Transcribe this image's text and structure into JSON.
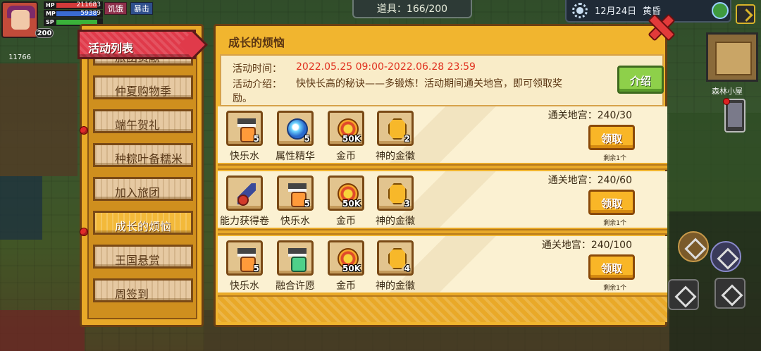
{
  "hud": {
    "level": "200",
    "hp_label": "HP",
    "hp_value": "211683",
    "mp_label": "MP",
    "mp_value": "59389",
    "sp_label": "SP",
    "status_hunger": "饥饿",
    "status_crit": "暴击",
    "coins": "11766",
    "items_text": "道具：166/200",
    "date": "12月24日",
    "time_of_day": "黄昏",
    "location": "森林小屋",
    "icons": [
      "portrait-icon",
      "sun-icon",
      "globe-icon",
      "exit-icon",
      "phone-icon",
      "minimap"
    ]
  },
  "sidebar": {
    "title": "活动列表",
    "items": [
      {
        "label": "旅团贡献",
        "badge": false,
        "active": false
      },
      {
        "label": "仲夏购物季",
        "badge": false,
        "active": false
      },
      {
        "label": "端午贺礼",
        "badge": true,
        "active": false
      },
      {
        "label": "种粽叶备糯米",
        "badge": false,
        "active": false
      },
      {
        "label": "加入旅团",
        "badge": false,
        "active": false
      },
      {
        "label": "成长的烦恼",
        "badge": true,
        "active": true
      },
      {
        "label": "王国悬赏",
        "badge": false,
        "active": false
      },
      {
        "label": "周签到",
        "badge": false,
        "active": false
      }
    ]
  },
  "panel": {
    "title": "成长的烦恼",
    "time_label": "活动时间：",
    "time_value": "2022.05.25 09:00-2022.06.28 23:59",
    "desc_label": "活动介绍：",
    "desc_value": "快快长高的秘诀——多锻炼！活动期间通关地宫，即可领取奖",
    "desc_line2": "励。",
    "intro_button": "介绍"
  },
  "rewards": [
    {
      "progress": "通关地宫：240/30",
      "claim": "领取",
      "remaining": "剩余1个",
      "items": [
        {
          "name": "快乐水",
          "count": "5",
          "icon": "potion-icon"
        },
        {
          "name": "属性精华",
          "count": "5",
          "icon": "orb-icon"
        },
        {
          "name": "金币",
          "count": "50K",
          "icon": "coin-icon"
        },
        {
          "name": "神的金徽",
          "count": "2",
          "icon": "badge-icon"
        }
      ]
    },
    {
      "progress": "通关地宫：240/60",
      "claim": "领取",
      "remaining": "剩余1个",
      "items": [
        {
          "name": "能力获得卷",
          "count": "",
          "icon": "scroll-icon"
        },
        {
          "name": "快乐水",
          "count": "5",
          "icon": "potion-icon"
        },
        {
          "name": "金币",
          "count": "50K",
          "icon": "coin-icon"
        },
        {
          "name": "神的金徽",
          "count": "3",
          "icon": "badge-icon"
        }
      ]
    },
    {
      "progress": "通关地宫：240/100",
      "claim": "领取",
      "remaining": "剩余1个",
      "items": [
        {
          "name": "快乐水",
          "count": "5",
          "icon": "potion-icon"
        },
        {
          "name": "融合许愿",
          "count": "",
          "icon": "fuse-potion-icon"
        },
        {
          "name": "金币",
          "count": "50K",
          "icon": "coin-icon"
        },
        {
          "name": "神的金徽",
          "count": "4",
          "icon": "badge-icon"
        }
      ]
    }
  ],
  "colors": {
    "panel_bg": "#f1b52f",
    "time_text": "#e0301e",
    "header_red": "#e03a4a",
    "intro_green": "#8ed04a"
  }
}
